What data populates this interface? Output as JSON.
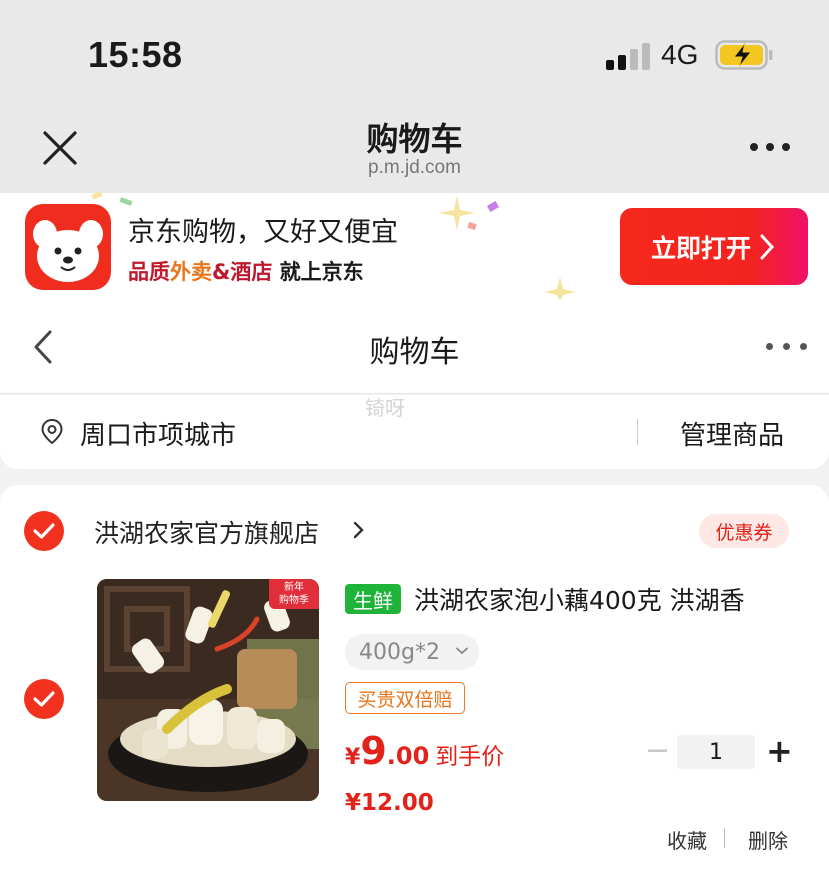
{
  "status_bar": {
    "time": "15:58",
    "network": "4G"
  },
  "browser": {
    "title": "购物车",
    "url": "p.m.jd.com"
  },
  "app_banner": {
    "title": "京东购物，又好又便宜",
    "subtitle_part1": "品质",
    "subtitle_part2": "外卖",
    "subtitle_part3": "&酒店",
    "subtitle_part4": " 就上京东",
    "open_button": "立即打开"
  },
  "page": {
    "title": "购物车",
    "watermark": "锜呀"
  },
  "address": {
    "location": "周口市项城市",
    "manage": "管理商品"
  },
  "shop": {
    "name": "洪湖农家官方旗舰店",
    "coupon": "优惠券",
    "product": {
      "image_badge": "新年\n购物季",
      "fresh_tag": "生鲜",
      "title": "洪湖农家泡小藕400克 洪湖香",
      "spec": "400g*2",
      "guarantee": "买贵双倍赔",
      "price_symbol": "¥",
      "price_int": "9",
      "price_dec": ".00",
      "price_label": "到手价",
      "original_price": "¥12.00",
      "quantity": "1",
      "favorite": "收藏",
      "delete": "删除"
    }
  },
  "colors": {
    "accent": "#e2231a",
    "fresh": "#1fb33a",
    "guarantee": "#e8751a"
  },
  "icons": [
    "close-icon",
    "more-icon",
    "back-icon",
    "location-icon",
    "check-icon",
    "chevron-right-icon",
    "chevron-down-icon",
    "minus-icon",
    "plus-icon"
  ]
}
